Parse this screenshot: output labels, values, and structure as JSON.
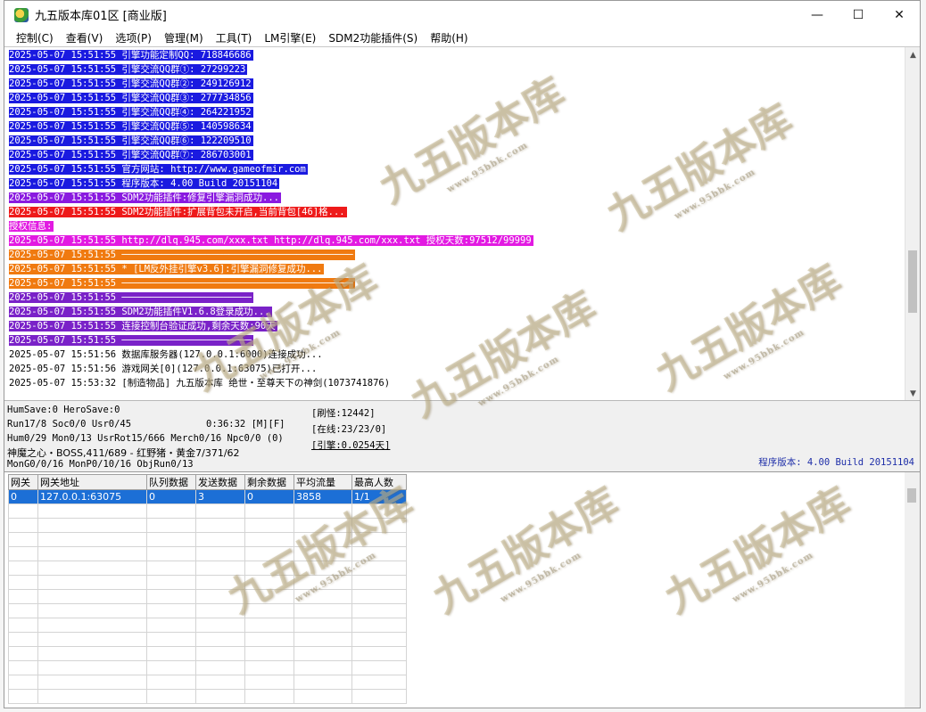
{
  "window": {
    "title": "九五版本库01区 [商业版]",
    "controls": {
      "minimize": "—",
      "maximize": "☐",
      "close": "✕"
    }
  },
  "menu": [
    "控制(C)",
    "查看(V)",
    "选项(P)",
    "管理(M)",
    "工具(T)",
    "LM引擎(E)",
    "SDM2功能插件(S)",
    "帮助(H)"
  ],
  "log": [
    {
      "text": "2025-05-07 15:51:55 引擎功能定制QQ: 718846686",
      "bg": "#1a1ae0",
      "fg": "#ffffff"
    },
    {
      "text": "2025-05-07 15:51:55 引擎交流QQ群①: 27299223",
      "bg": "#1a1ae0",
      "fg": "#ffffff"
    },
    {
      "text": "2025-05-07 15:51:55 引擎交流QQ群②: 249126912",
      "bg": "#1a1ae0",
      "fg": "#ffffff"
    },
    {
      "text": "2025-05-07 15:51:55 引擎交流QQ群③: 277734856",
      "bg": "#1a1ae0",
      "fg": "#ffffff"
    },
    {
      "text": "2025-05-07 15:51:55 引擎交流QQ群④: 264221952",
      "bg": "#1a1ae0",
      "fg": "#ffffff"
    },
    {
      "text": "2025-05-07 15:51:55 引擎交流QQ群⑤: 140598634",
      "bg": "#1a1ae0",
      "fg": "#ffffff"
    },
    {
      "text": "2025-05-07 15:51:55 引擎交流QQ群⑥: 122209510",
      "bg": "#1a1ae0",
      "fg": "#ffffff"
    },
    {
      "text": "2025-05-07 15:51:55 引擎交流QQ群⑦: 286703001",
      "bg": "#1a1ae0",
      "fg": "#ffffff"
    },
    {
      "text": "2025-05-07 15:51:55 官方网站: http://www.gameofmir.com",
      "bg": "#1a1ae0",
      "fg": "#ffffff"
    },
    {
      "text": "2025-05-07 15:51:55 程序版本: 4.00 Build 20151104",
      "bg": "#1a1ae0",
      "fg": "#ffffff"
    },
    {
      "text": "2025-05-07 15:51:55 SDM2功能插件:修复引擎漏洞成功...",
      "bg": "#8a1ae0",
      "fg": "#ffffff"
    },
    {
      "text": "2025-05-07 15:51:55 SDM2功能插件:扩展背包未开启,当前背包[46]格...",
      "bg": "#ee1a1a",
      "fg": "#ffffff"
    },
    {
      "text": "授权信息:",
      "bg": "#e21ae2",
      "fg": "#ffffff"
    },
    {
      "text": "2025-05-07 15:51:55 http://dlq.945.com/xxx.txt http://dlq.945.com/xxx.txt 授权天数:97512/99999",
      "bg": "#e21ae2",
      "fg": "#ffffff"
    },
    {
      "text": "2025-05-07 15:51:55 ─────────────────────────────────────────",
      "bg": "#f07a10",
      "fg": "#ffffff"
    },
    {
      "text": "2025-05-07 15:51:55 * [LM反外挂引擎v3.6]:引擎漏洞修复成功...",
      "bg": "#f07a10",
      "fg": "#ffffff"
    },
    {
      "text": "2025-05-07 15:51:55 ─────────────────────────────────────────",
      "bg": "#f07a10",
      "fg": "#ffffff"
    },
    {
      "text": "2025-05-07 15:51:55 ───────────────────────",
      "bg": "#7a22c8",
      "fg": "#ffffff"
    },
    {
      "text": "2025-05-07 15:51:55 SDM2功能插件V1.6.8登录成功...",
      "bg": "#7a22c8",
      "fg": "#ffffff"
    },
    {
      "text": "2025-05-07 15:51:55 连接控制台验证成功,剩余天数:90天",
      "bg": "#7a22c8",
      "fg": "#ffffff"
    },
    {
      "text": "2025-05-07 15:51:55 ───────────────────────",
      "bg": "#7a22c8",
      "fg": "#ffffff"
    },
    {
      "text": "2025-05-07 15:51:56 数据库服务器(127.0.0.1:6000)连接成功...",
      "bg": "",
      "fg": "#000000"
    },
    {
      "text": "2025-05-07 15:51:56 游戏网关[0](127.0.0.1:63075)已打开...",
      "bg": "",
      "fg": "#000000"
    },
    {
      "text": "2025-05-07 15:53:32 [制造物品] 九五版本库 绝世・至尊天下の神剑(1073741876)",
      "bg": "",
      "fg": "#000000"
    }
  ],
  "status": {
    "humsave": "HumSave:0 HeroSave:0",
    "run": "Run17/8 Soc0/0 Usr0/45",
    "time": "0:36:32 [M][F]",
    "hum": "Hum0/29 Mon0/13 UsrRot15/666 Merch0/16 Npc0/0 (0)",
    "boss": "神魔之心・BOSS,411/689 - 红野猪・黄金7/371/62",
    "mong": "MonG0/0/16 MonP0/10/16 ObjRun0/13",
    "refresh": "[刷怪:12442]",
    "online": "[在线:23/23/0]",
    "engine": "[引擎:0.0254天]",
    "version": "程序版本: 4.00 Build 20151104"
  },
  "grid": {
    "headers": [
      "网关",
      "网关地址",
      "队列数据",
      "发送数据",
      "剩余数据",
      "平均流量",
      "最高人数"
    ],
    "rows": [
      [
        "0",
        "127.0.0.1:63075",
        "0",
        "3",
        "0",
        "3858",
        "1/1"
      ]
    ]
  },
  "watermark": {
    "text": "九五版本库",
    "sub": "www.95bbk.com"
  }
}
